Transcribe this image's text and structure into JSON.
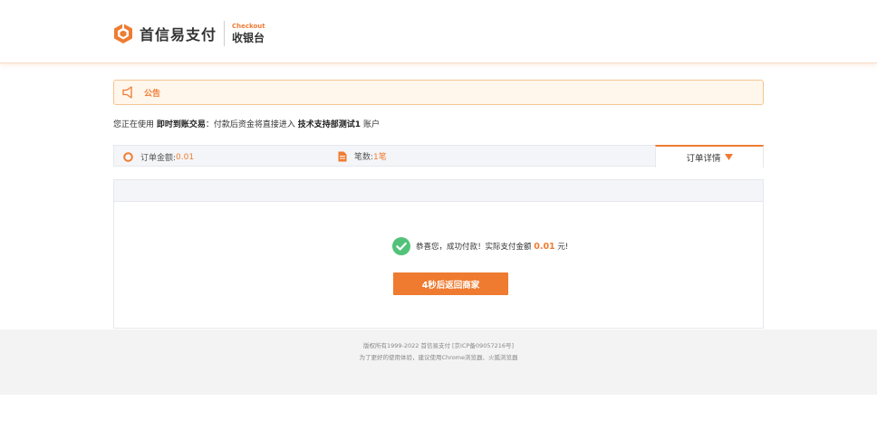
{
  "brand": {
    "name": "首信易支付",
    "checkout_en": "Checkout",
    "checkout_cn": "收银台",
    "accent": "#ef7c32"
  },
  "notice": {
    "icon": "speaker-icon",
    "label": "公告"
  },
  "info": {
    "prefix": "您正在使用",
    "mode": "即时到账交易",
    "middle": "：付款后资金将直接进入",
    "merchant": "技术支持部测试1",
    "suffix": "账户"
  },
  "order": {
    "amount_label": "订单金额:",
    "amount_value": "0.01",
    "count_label": "笔数:",
    "count_value": "1笔",
    "detail_label": "订单详情"
  },
  "result": {
    "success_prefix": "恭喜您，成功付款！实际支付金额",
    "success_amount": "0.01",
    "success_suffix": "元!",
    "return_button": "4秒后返回商家"
  },
  "footer": {
    "line1": "版权所有1999-2022 首信易支付 [京ICP备09057216号]",
    "line2": "为了更好的使用体验，建议使用Chrome浏览器、火狐浏览器"
  }
}
